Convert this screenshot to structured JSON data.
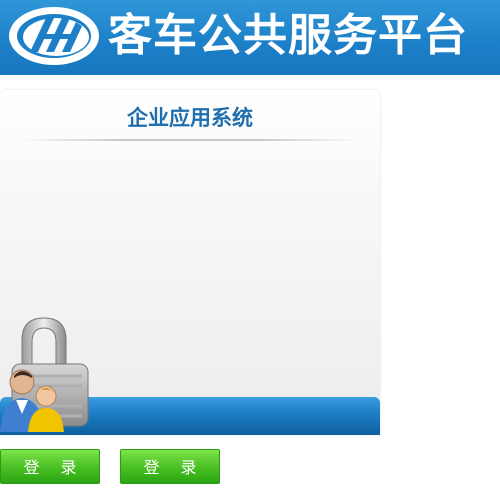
{
  "header": {
    "logo_icon": "ch-logo-icon",
    "title": "客车公共服务平台"
  },
  "panel": {
    "title": "企业应用系统",
    "illustration_icon": "padlock-users-icon"
  },
  "buttons": [
    {
      "label": "登 录"
    },
    {
      "label": "登 录"
    }
  ],
  "colors": {
    "header_blue": "#1c7fc7",
    "title_blue": "#1f6fae",
    "button_green": "#4cc226"
  }
}
